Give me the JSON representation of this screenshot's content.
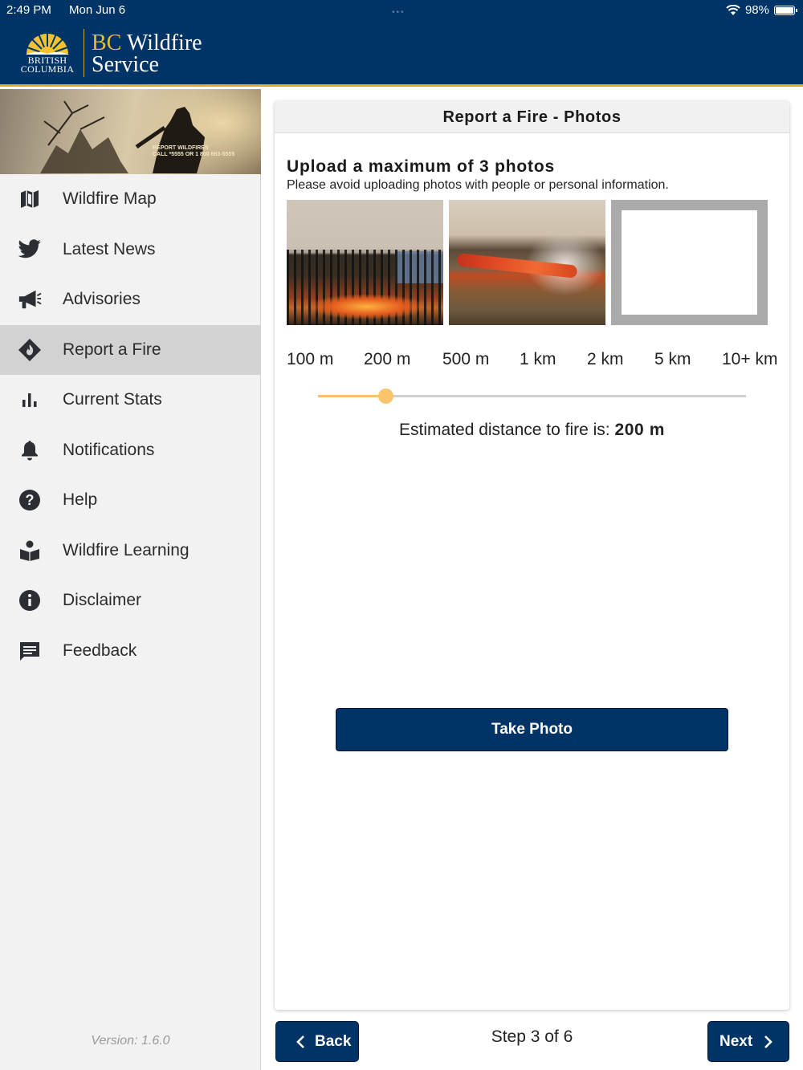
{
  "status_bar": {
    "time": "2:49 PM",
    "date": "Mon Jun 6",
    "battery": "98%"
  },
  "brand": {
    "province_line1": "BRITISH",
    "province_line2": "COLUMBIA",
    "title_bc": "BC",
    "title_rest": " Wildfire",
    "title_line2": "Service",
    "colors": {
      "navy": "#003366",
      "gold": "#e3a82b"
    }
  },
  "sidebar": {
    "banner_text_line1": "REPORT WILDFIRES",
    "banner_text_line2": "CALL *5555 OR 1 800 663-5555",
    "items": [
      {
        "label": "Wildfire Map",
        "icon": "map-icon"
      },
      {
        "label": "Latest News",
        "icon": "twitter-icon"
      },
      {
        "label": "Advisories",
        "icon": "megaphone-icon"
      },
      {
        "label": "Report a Fire",
        "icon": "fire-report-icon",
        "active": true
      },
      {
        "label": "Current Stats",
        "icon": "bar-chart-icon"
      },
      {
        "label": "Notifications",
        "icon": "bell-icon"
      },
      {
        "label": "Help",
        "icon": "help-icon"
      },
      {
        "label": "Wildfire Learning",
        "icon": "learning-icon"
      },
      {
        "label": "Disclaimer",
        "icon": "info-icon"
      },
      {
        "label": "Feedback",
        "icon": "feedback-icon"
      }
    ],
    "version": "Version: 1.6.0"
  },
  "main": {
    "header": "Report a Fire - Photos",
    "upload_title": "Upload a maximum of 3 photos",
    "upload_subtitle": "Please avoid uploading photos with people or personal information.",
    "photos_count": 2,
    "photo_slots": 3,
    "distance_options": [
      "100 m",
      "200 m",
      "500 m",
      "1 km",
      "2 km",
      "5 km",
      "10+ km"
    ],
    "selected_distance_index": 1,
    "estimate_prefix": "Estimated distance to fire is: ",
    "estimate_value": "200 m",
    "take_photo_label": "Take Photo"
  },
  "footer": {
    "back_label": "Back",
    "next_label": "Next",
    "step_text": "Step 3 of 6"
  }
}
